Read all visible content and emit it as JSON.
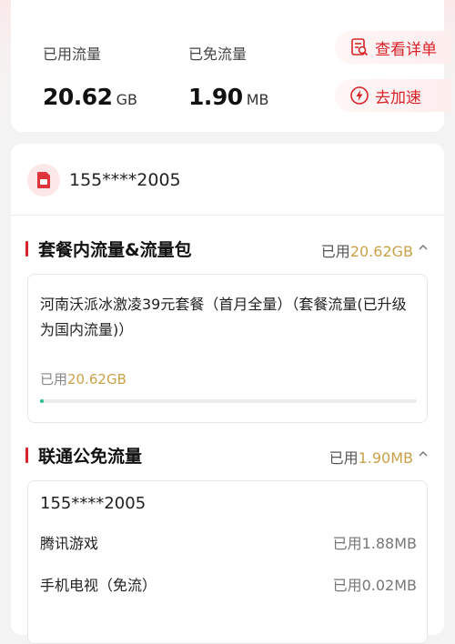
{
  "summary": {
    "used_label": "已用流量",
    "used_value": "20.62",
    "used_unit": "GB",
    "free_label": "已免流量",
    "free_value": "1.90",
    "free_unit": "MB",
    "details_label": "查看详单",
    "speedup_label": "去加速"
  },
  "account": {
    "phone": "155****2005"
  },
  "package_section": {
    "title": "套餐内流量&流量包",
    "used_prefix": "已用",
    "used_amount": "20.62GB",
    "plan": {
      "name": "河南沃派冰激凌39元套餐（首月全量）（套餐流量(已升级为国内流量)）",
      "used_prefix": "已用",
      "used_amount": "20.62GB",
      "progress_fraction": 0.01
    }
  },
  "free_section": {
    "title": "联通公免流量",
    "used_prefix": "已用",
    "used_amount": "1.90MB",
    "phone": "155****2005",
    "items": [
      {
        "name": "腾讯游戏",
        "used": "已用1.88MB"
      },
      {
        "name": "手机电视（免流）",
        "used": "已用0.02MB"
      }
    ]
  },
  "colors": {
    "accent": "#d8232a",
    "gold": "#c8a24a",
    "progress": "#27c08b"
  }
}
